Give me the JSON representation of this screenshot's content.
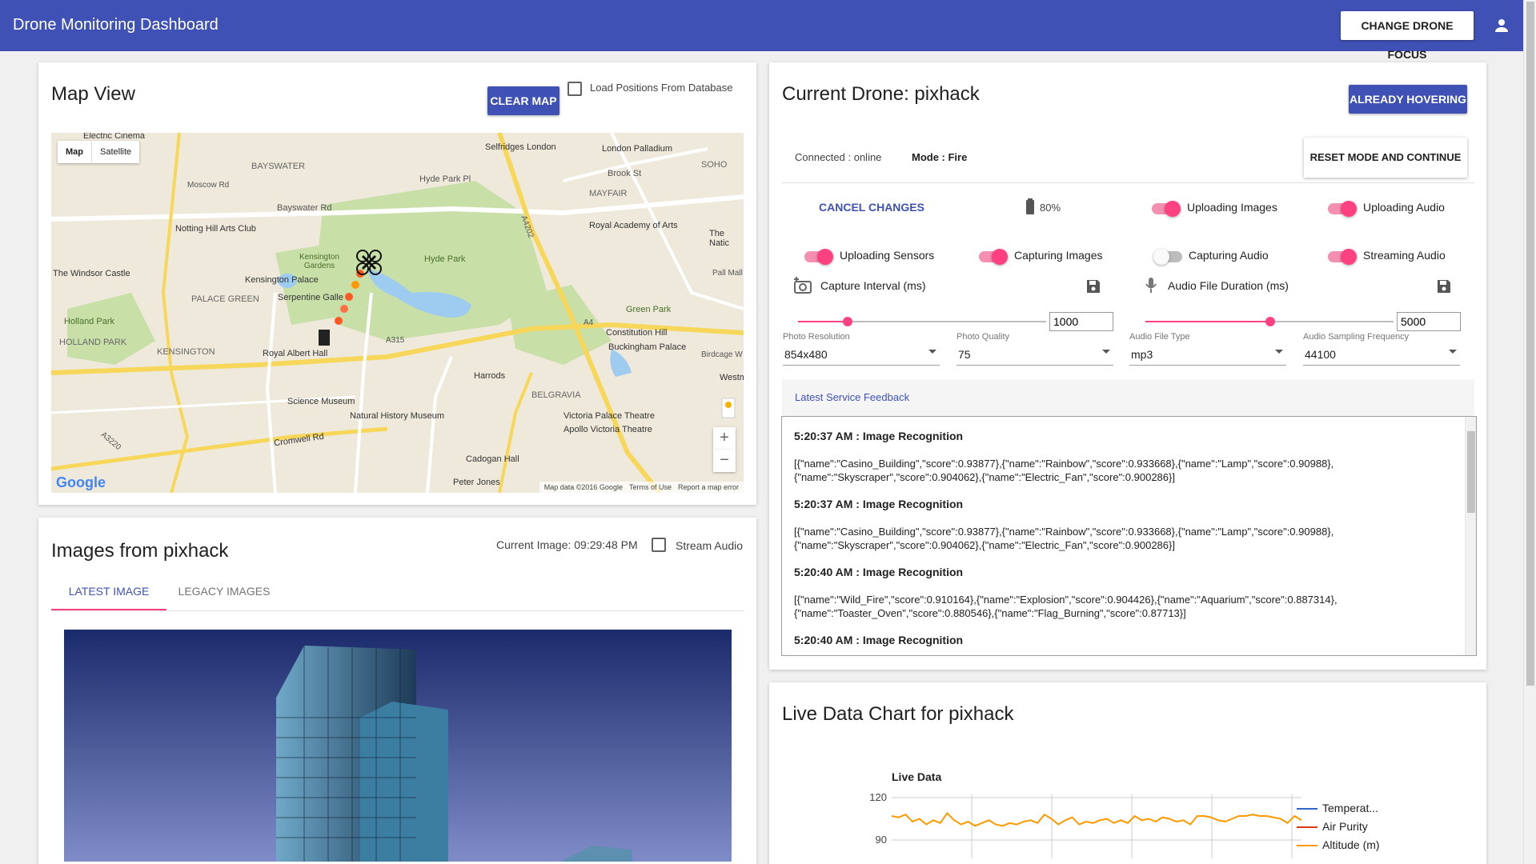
{
  "appbar": {
    "title": "Drone Monitoring Dashboard",
    "focus_button": "CHANGE DRONE FOCUS",
    "account_icon": "account-icon",
    "color": "#3f51b5"
  },
  "map_card": {
    "title": "Map View",
    "clear_button": "CLEAR MAP",
    "load_label": "Load Positions From Database",
    "map_tabs": [
      "Map",
      "Satellite"
    ],
    "places": {
      "electric_cinema": "Electric Cinema",
      "selfridges": "Selfridges London",
      "london_palladium": "London Palladium",
      "soho": "SOHO",
      "bayswater": "BAYSWATER",
      "moscow_rd": "Moscow Rd",
      "hyde_park_pl": "Hyde Park Pl",
      "brook_st": "Brook St",
      "mayfair": "MAYFAIR",
      "bayswater_rd": "Bayswater Rd",
      "notting_hill": "Notting Hill Arts Club",
      "royal_academy": "Royal Academy of Arts",
      "the_natio": "The Natic",
      "kensington_gardens": "Kensington Gardens",
      "hyde_park": "Hyde Park",
      "windsor_castle": "The Windsor Castle",
      "kensington_palace": "Kensington Palace",
      "palace_green": "PALACE GREEN",
      "serpentine": "Serpentine Galle",
      "green_park": "Green Park",
      "pall_mall": "Pall Mall",
      "holland_park": "Holland Park",
      "holland_park_caps": "HOLLAND PARK",
      "constitution_hill": "Constitution Hill",
      "buckingham_palace": "Buckingham Palace",
      "kensington": "KENSINGTON",
      "royal_albert_hall": "Royal Albert Hall",
      "birdcage": "Birdcage W",
      "harrods": "Harrods",
      "westm": "Westm",
      "belgravia": "BELGRAVIA",
      "science_museum": "Science Museum",
      "natural_history": "Natural History Museum",
      "victoria_palace": "Victoria Palace Theatre",
      "apollo_victoria": "Apollo Victoria Theatre",
      "cromwell_rd": "Cromwell Rd",
      "cadogan_hall": "Cadogan Hall",
      "peter_jones": "Peter Jones",
      "a315": "A315",
      "a4": "A4",
      "a4202": "A4202",
      "a3220": "A3220"
    },
    "footer": [
      "Map data ©2016 Google",
      "Terms of Use",
      "Report a map error"
    ],
    "google_logo": "Google",
    "zoom_in": "+",
    "zoom_out": "−"
  },
  "images_card": {
    "title": "Images from pixhack",
    "current_image": "Current Image: 09:29:48 PM",
    "stream_audio": "Stream Audio",
    "tabs": [
      "LATEST IMAGE",
      "LEGACY IMAGES"
    ]
  },
  "drone_card": {
    "title": "Current Drone: pixhack",
    "hover_button": "ALREADY HOVERING",
    "connected": "Connected : online",
    "mode": "Mode : Fire",
    "reset_button": "RESET MODE AND CONTINUE",
    "cancel_changes": "CANCEL CHANGES",
    "battery": "80%",
    "toggles": [
      {
        "label": "Uploading Images",
        "on": true
      },
      {
        "label": "Uploading Audio",
        "on": true
      },
      {
        "label": "Uploading Sensors",
        "on": true
      },
      {
        "label": "Capturing Images",
        "on": true
      },
      {
        "label": "Capturing Audio",
        "on": false
      },
      {
        "label": "Streaming Audio",
        "on": true
      }
    ],
    "capture_interval": {
      "label": "Capture Interval (ms)",
      "value": "1000",
      "slider_fraction": 0.2
    },
    "audio_duration": {
      "label": "Audio File Duration (ms)",
      "value": "5000",
      "slider_fraction": 0.5
    },
    "selects": [
      {
        "label": "Photo Resolution",
        "value": "854x480"
      },
      {
        "label": "Photo Quality",
        "value": "75"
      },
      {
        "label": "Audio File Type",
        "value": "mp3"
      },
      {
        "label": "Audio Sampling Frequency",
        "value": "44100"
      }
    ],
    "feedback_header": "Latest Service Feedback",
    "feedback": [
      {
        "title": "5:20:37 AM : Image Recognition",
        "body": "[{\"name\":\"Casino_Building\",\"score\":0.93877},{\"name\":\"Rainbow\",\"score\":0.933668},{\"name\":\"Lamp\",\"score\":0.90988},{\"name\":\"Skyscraper\",\"score\":0.904062},{\"name\":\"Electric_Fan\",\"score\":0.900286}]"
      },
      {
        "title": "5:20:37 AM : Image Recognition",
        "body": "[{\"name\":\"Casino_Building\",\"score\":0.93877},{\"name\":\"Rainbow\",\"score\":0.933668},{\"name\":\"Lamp\",\"score\":0.90988},{\"name\":\"Skyscraper\",\"score\":0.904062},{\"name\":\"Electric_Fan\",\"score\":0.900286}]"
      },
      {
        "title": "5:20:40 AM : Image Recognition",
        "body": "[{\"name\":\"Wild_Fire\",\"score\":0.910164},{\"name\":\"Explosion\",\"score\":0.904426},{\"name\":\"Aquarium\",\"score\":0.887314},{\"name\":\"Toaster_Oven\",\"score\":0.880546},{\"name\":\"Flag_Burning\",\"score\":0.87713}]"
      },
      {
        "title": "5:20:40 AM : Image Recognition",
        "body": ""
      }
    ],
    "accent": "#ff4081"
  },
  "chart_card": {
    "title": "Live Data Chart for pixhack"
  },
  "chart_data": {
    "type": "line",
    "title": "Live Data",
    "ylim_visible": [
      90,
      120
    ],
    "yticks": [
      120,
      90
    ],
    "series": [
      {
        "name": "Temperat...",
        "color": "#3366cc",
        "values": []
      },
      {
        "name": "Air Purity",
        "color": "#dc3912",
        "values": []
      },
      {
        "name": "Altitude (m)",
        "color": "#ff9900",
        "values": [
          107,
          106,
          108,
          103,
          105,
          101,
          104,
          102,
          109,
          104,
          101,
          103,
          100,
          102,
          104,
          101,
          100,
          102,
          101,
          103,
          104,
          102,
          108,
          105,
          101,
          104,
          106,
          101,
          103,
          102,
          104,
          105,
          102,
          104,
          102,
          107,
          104,
          105,
          103,
          106,
          105,
          103,
          104,
          101,
          107,
          107,
          106,
          104,
          103,
          105,
          107,
          107,
          108,
          107,
          107,
          106,
          105,
          102,
          107,
          104
        ]
      }
    ],
    "legend": "right"
  }
}
